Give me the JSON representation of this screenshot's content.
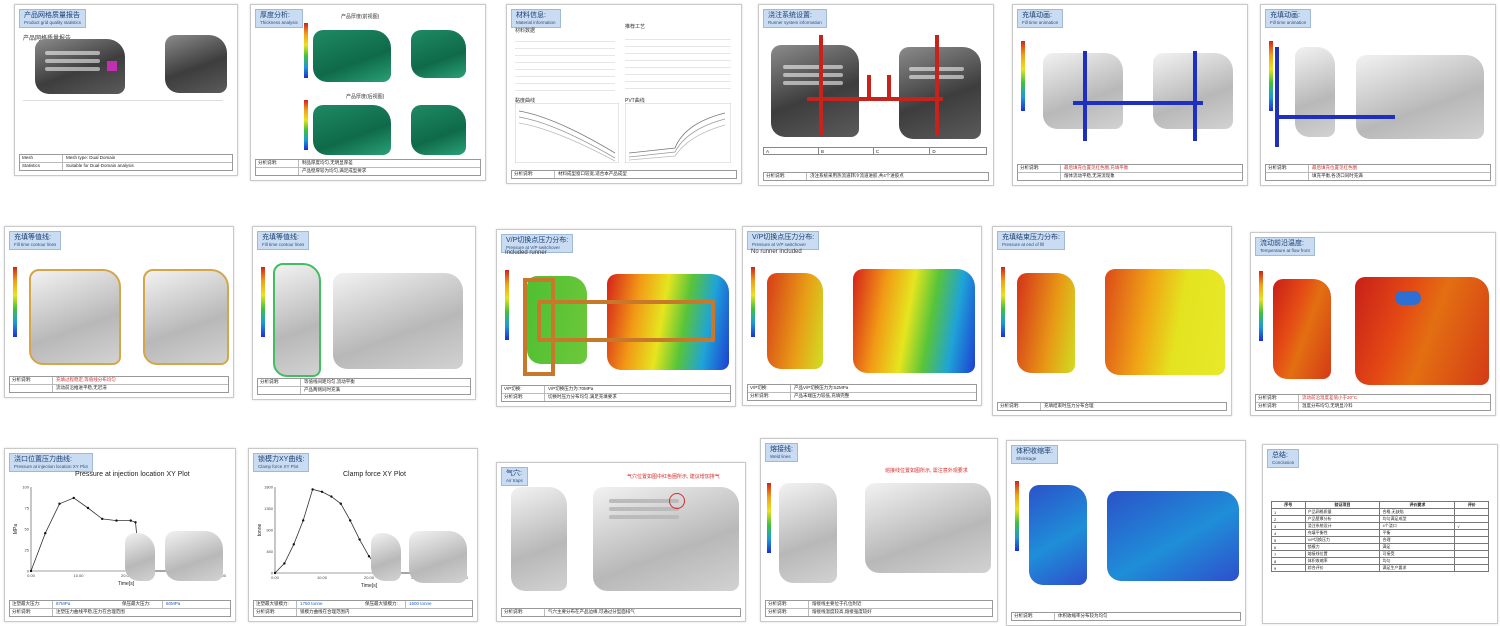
{
  "slides": [
    {
      "title": "产品网格质量报告",
      "en": "Product grid quality statistics",
      "sub": "产品网格质量报告",
      "foot": [
        [
          "Mesh",
          "Mesh type: Dual Domain"
        ],
        [
          "Statistics",
          "Suitable for Dual-Domain analysis"
        ]
      ]
    },
    {
      "title": "厚度分析:",
      "en": "Thickness analysis",
      "sub_top": "产品厚度(前视图)",
      "sub_bot": "产品厚度(后视图)",
      "foot": [
        [
          "分析说明:",
          "制品厚度均匀,无明显厚差"
        ],
        [
          "",
          "产品壁厚较为均匀,满足成型要求"
        ]
      ]
    },
    {
      "title": "材料信息:",
      "en": "Material information",
      "left_head": "材料数据",
      "right_head": "推荐工艺",
      "chart1": "黏度曲线",
      "chart2": "PVT曲线",
      "foot": [
        [
          "分析说明:",
          "材料成型窗口较宽,适合本产品成型"
        ]
      ]
    },
    {
      "title": "浇注系统设置:",
      "en": "Runner system information",
      "cols": [
        "A",
        "B",
        "C",
        "D"
      ],
      "foot": [
        [
          "分析说明:",
          "浇注系统采用热流道转冷流道进胶,共4个进胶点"
        ]
      ]
    },
    {
      "title": "充填动画:",
      "en": "Fill time animation",
      "foot": [
        [
          "分析说明:",
          "最后填充位置见红色圈,充填平衡"
        ],
        [
          "",
          "熔体流动平稳,无滞流现象"
        ]
      ]
    },
    {
      "title": "充填动画:",
      "en": "Fill time animation",
      "foot": [
        [
          "分析说明:",
          "最后填充位置见红色圈"
        ],
        [
          "",
          "填充平衡,各浇口同时充满"
        ]
      ]
    },
    {
      "title": "充填等值线:",
      "en": "Fill time contour lines",
      "foot": [
        [
          "分析说明:",
          "充填过程稳定,等值线分布均匀"
        ],
        [
          "",
          "流动前沿推进平稳,无迟滞"
        ]
      ]
    },
    {
      "title": "充填等值线:",
      "en": "Fill time contour lines",
      "foot": [
        [
          "分析说明:",
          "等值线间距均匀,流动平衡"
        ],
        [
          "",
          "产品两侧同时充满"
        ]
      ]
    },
    {
      "title": "V/P切换点压力分布:",
      "en": "Pressure at V/P switchover",
      "sub": "Included runner",
      "foot": [
        [
          "V/P切换:",
          "V/P切换压力为:70MPa"
        ],
        [
          "分析说明:",
          "切换时压力分布均匀,满足充填要求"
        ]
      ]
    },
    {
      "title": "V/P切换点压力分布:",
      "en": "Pressure at V/P switchover",
      "sub": "No runner included",
      "foot": [
        [
          "V/P切换:",
          "产品V/P切换压力为:52MPa"
        ],
        [
          "分析说明:",
          "产品末端压力较低,充填完整"
        ]
      ]
    },
    {
      "title": "充填结束压力分布:",
      "en": "Pressure at end of fill",
      "foot": [
        [
          "分析说明:",
          "充填结束时压力分布合理"
        ]
      ]
    },
    {
      "title": "流动前沿温度:",
      "en": "Temperature at flow front",
      "foot": [
        [
          "分析说明:",
          "流动前沿温度差值小于20°C"
        ],
        [
          "分析说明:",
          "温度分布均匀,无明显冷料"
        ]
      ]
    },
    {
      "title": "浇口位置压力曲线:",
      "en": "Pressure at injection location XY Plot",
      "plot": "Pressure at injection location XY Plot",
      "ylabel": "MPa",
      "xlabel": "Time[s]",
      "foot": [
        [
          "注塑最大压力:",
          "87MPa",
          "保压最大压力:",
          "60MPa"
        ],
        [
          "分析说明:",
          "注塑压力曲线平稳,压力在合理范围"
        ]
      ]
    },
    {
      "title": "锁模力XY曲线:",
      "en": "Clamp force XY Plot",
      "plot": "Clamp force XY Plot",
      "ylabel": "tonne",
      "xlabel": "Time[s]",
      "foot": [
        [
          "注塑最大锁模力:",
          "1750 tonne",
          "保压最大锁模力:",
          "1600 tonne"
        ],
        [
          "分析说明:",
          "锁模力曲线在合理范围内"
        ]
      ]
    },
    {
      "title": "气穴:",
      "en": "Air traps",
      "annot": "气穴位置如图中红色圈所示, 建议增加排气",
      "foot": [
        [
          "分析说明:",
          "气穴主要分布在产品边缘,可通过分型面排气"
        ]
      ]
    },
    {
      "title": "熔接线:",
      "en": "Weld lines",
      "annot": "熔接线位置如图所示, 需注意外观要求",
      "foot": [
        [
          "分析说明:",
          "熔接线主要位于孔位附近"
        ],
        [
          "分析说明:",
          "熔接线温度较高,熔接强度较好"
        ]
      ]
    },
    {
      "title": "体积收缩率:",
      "en": "Shrinkage",
      "foot": [
        [
          "分析说明:",
          "体积收缩率分布较为均匀"
        ]
      ]
    },
    {
      "title": "总结:",
      "en": "Conclusion",
      "table_head": [
        "序号",
        "验证项目",
        "评价要求",
        "评价"
      ],
      "table_rows": [
        [
          "1",
          "产品网格质量",
          "合格,无缺陷",
          ""
        ],
        [
          "2",
          "产品壁厚分析",
          "均匀满足成型",
          ""
        ],
        [
          "3",
          "浇注系统设计",
          "4个浇口",
          "√"
        ],
        [
          "4",
          "充填平衡性",
          "平衡",
          ""
        ],
        [
          "5",
          "V/P切换压力",
          "合理",
          ""
        ],
        [
          "6",
          "锁模力",
          "满足",
          ""
        ],
        [
          "7",
          "熔接线位置",
          "可接受",
          ""
        ],
        [
          "8",
          "体积收缩率",
          "均匀",
          ""
        ],
        [
          "9",
          "综合评价",
          "满足生产要求",
          ""
        ]
      ]
    }
  ],
  "colors": {
    "accent": "#c9dcf2",
    "red": "#d52b2b"
  },
  "chart_data": [
    {
      "type": "line",
      "title": "Pressure at injection location XY Plot",
      "xlabel": "Time[s]",
      "ylabel": "MPa",
      "x": [
        0,
        3,
        6,
        9,
        12,
        15,
        18,
        21,
        22,
        23,
        30,
        40
      ],
      "y": [
        0,
        45,
        80,
        87,
        75,
        62,
        60,
        60,
        58,
        0,
        0,
        0
      ],
      "ylim": [
        0,
        100
      ],
      "xlim": [
        0,
        40
      ]
    },
    {
      "type": "line",
      "title": "Clamp force XY Plot",
      "xlabel": "Time[s]",
      "ylabel": "tonne",
      "x": [
        0,
        2,
        4,
        6,
        8,
        10,
        12,
        14,
        16,
        18,
        20,
        22,
        24,
        30,
        40
      ],
      "y": [
        0,
        200,
        600,
        1100,
        1750,
        1700,
        1600,
        1450,
        1100,
        700,
        350,
        100,
        0,
        0,
        0
      ],
      "ylim": [
        0,
        1800
      ],
      "xlim": [
        0,
        40
      ]
    }
  ]
}
